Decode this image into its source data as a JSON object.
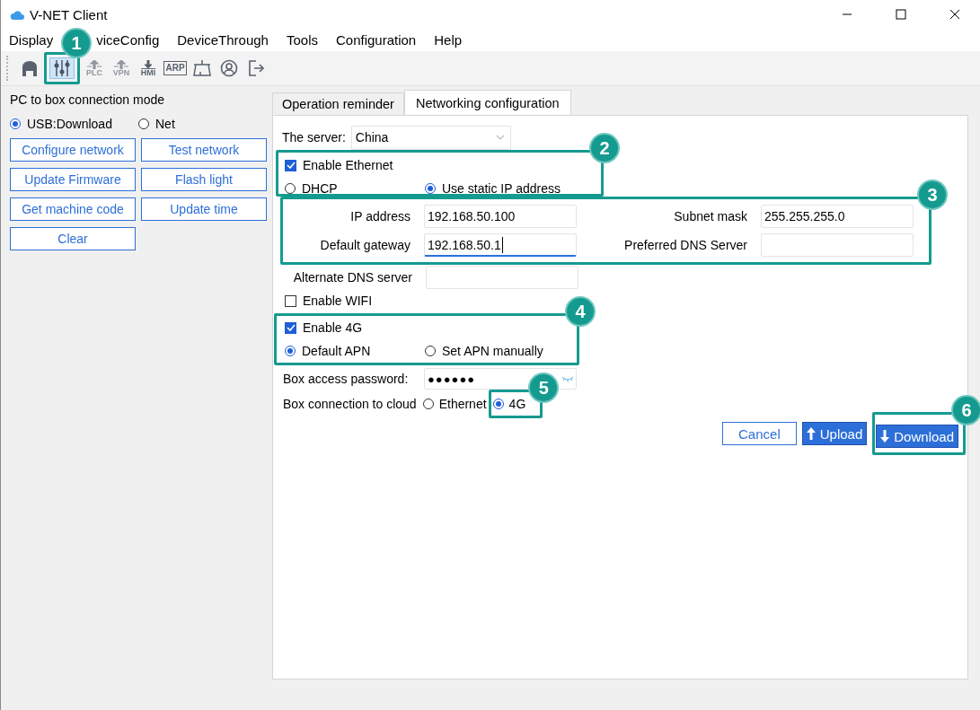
{
  "window": {
    "title": "V-NET Client"
  },
  "menu": [
    {
      "label": "Display"
    },
    {
      "label": "viceConfig"
    },
    {
      "label": "DeviceThrough"
    },
    {
      "label": "Tools"
    },
    {
      "label": "Configuration"
    },
    {
      "label": "Help"
    }
  ],
  "toolbar": [
    {
      "kind": "home",
      "selected": false,
      "disabled": false
    },
    {
      "kind": "sliders",
      "selected": true,
      "disabled": false,
      "callout": "1"
    },
    {
      "kind": "arrow-label",
      "label": "PLC",
      "selected": false,
      "disabled": true
    },
    {
      "kind": "arrow-label",
      "label": "VPN",
      "selected": false,
      "disabled": true
    },
    {
      "kind": "download-label",
      "label": "HMI",
      "selected": false,
      "disabled": false
    },
    {
      "kind": "box-label",
      "label": "ARP",
      "selected": false,
      "disabled": false
    },
    {
      "kind": "network",
      "selected": false,
      "disabled": false
    },
    {
      "kind": "user",
      "selected": false,
      "disabled": false
    },
    {
      "kind": "exit",
      "selected": false,
      "disabled": false
    }
  ],
  "connection": {
    "title": "PC to box connection mode",
    "options": [
      {
        "label": "USB:Download",
        "selected": true
      },
      {
        "label": "Net",
        "selected": false
      }
    ],
    "buttons": [
      "Configure network",
      "Test network",
      "Update Firmware",
      "Flash light",
      "Get machine code",
      "Update time",
      "Clear"
    ]
  },
  "tabs": [
    {
      "label": "Operation reminder",
      "selected": false
    },
    {
      "label": "Networking configuration",
      "selected": true
    }
  ],
  "server": {
    "label": "The server:",
    "value": "China"
  },
  "ethernet": {
    "callout": "2",
    "label": "Enable Ethernet",
    "checked": true,
    "modes": [
      {
        "label": "DHCP",
        "selected": false
      },
      {
        "label": "Use static IP address",
        "selected": true
      }
    ]
  },
  "ip_fields": {
    "callout": "3",
    "fields": [
      {
        "label": "IP address",
        "value": "192.168.50.100",
        "focused": false
      },
      {
        "label": "Subnet mask",
        "value": "255.255.255.0",
        "focused": false
      },
      {
        "label": "Default gateway",
        "value": "192.168.50.1",
        "focused": true
      },
      {
        "label": "Preferred DNS Server",
        "focused": false
      }
    ]
  },
  "alternate_dns": {
    "label": "Alternate DNS server"
  },
  "wifi": {
    "label": "Enable WIFI",
    "checked": false
  },
  "cellular": {
    "callout": "4",
    "label": "Enable 4G",
    "checked": true,
    "apn": [
      {
        "label": "Default APN",
        "selected": true
      },
      {
        "label": "Set APN manually",
        "selected": false
      }
    ]
  },
  "password": {
    "label": "Box access password:",
    "value": "●●●●●●"
  },
  "cloud": {
    "label": "Box connection to cloud",
    "options": [
      {
        "label": "Ethernet",
        "selected": false
      },
      {
        "label": "4G",
        "selected": true,
        "callout": "5"
      }
    ]
  },
  "actions": [
    {
      "label": "Cancel",
      "kind": "cancel"
    },
    {
      "label": "Upload",
      "kind": "upload"
    },
    {
      "label": "Download",
      "kind": "download",
      "callout": "6"
    }
  ]
}
